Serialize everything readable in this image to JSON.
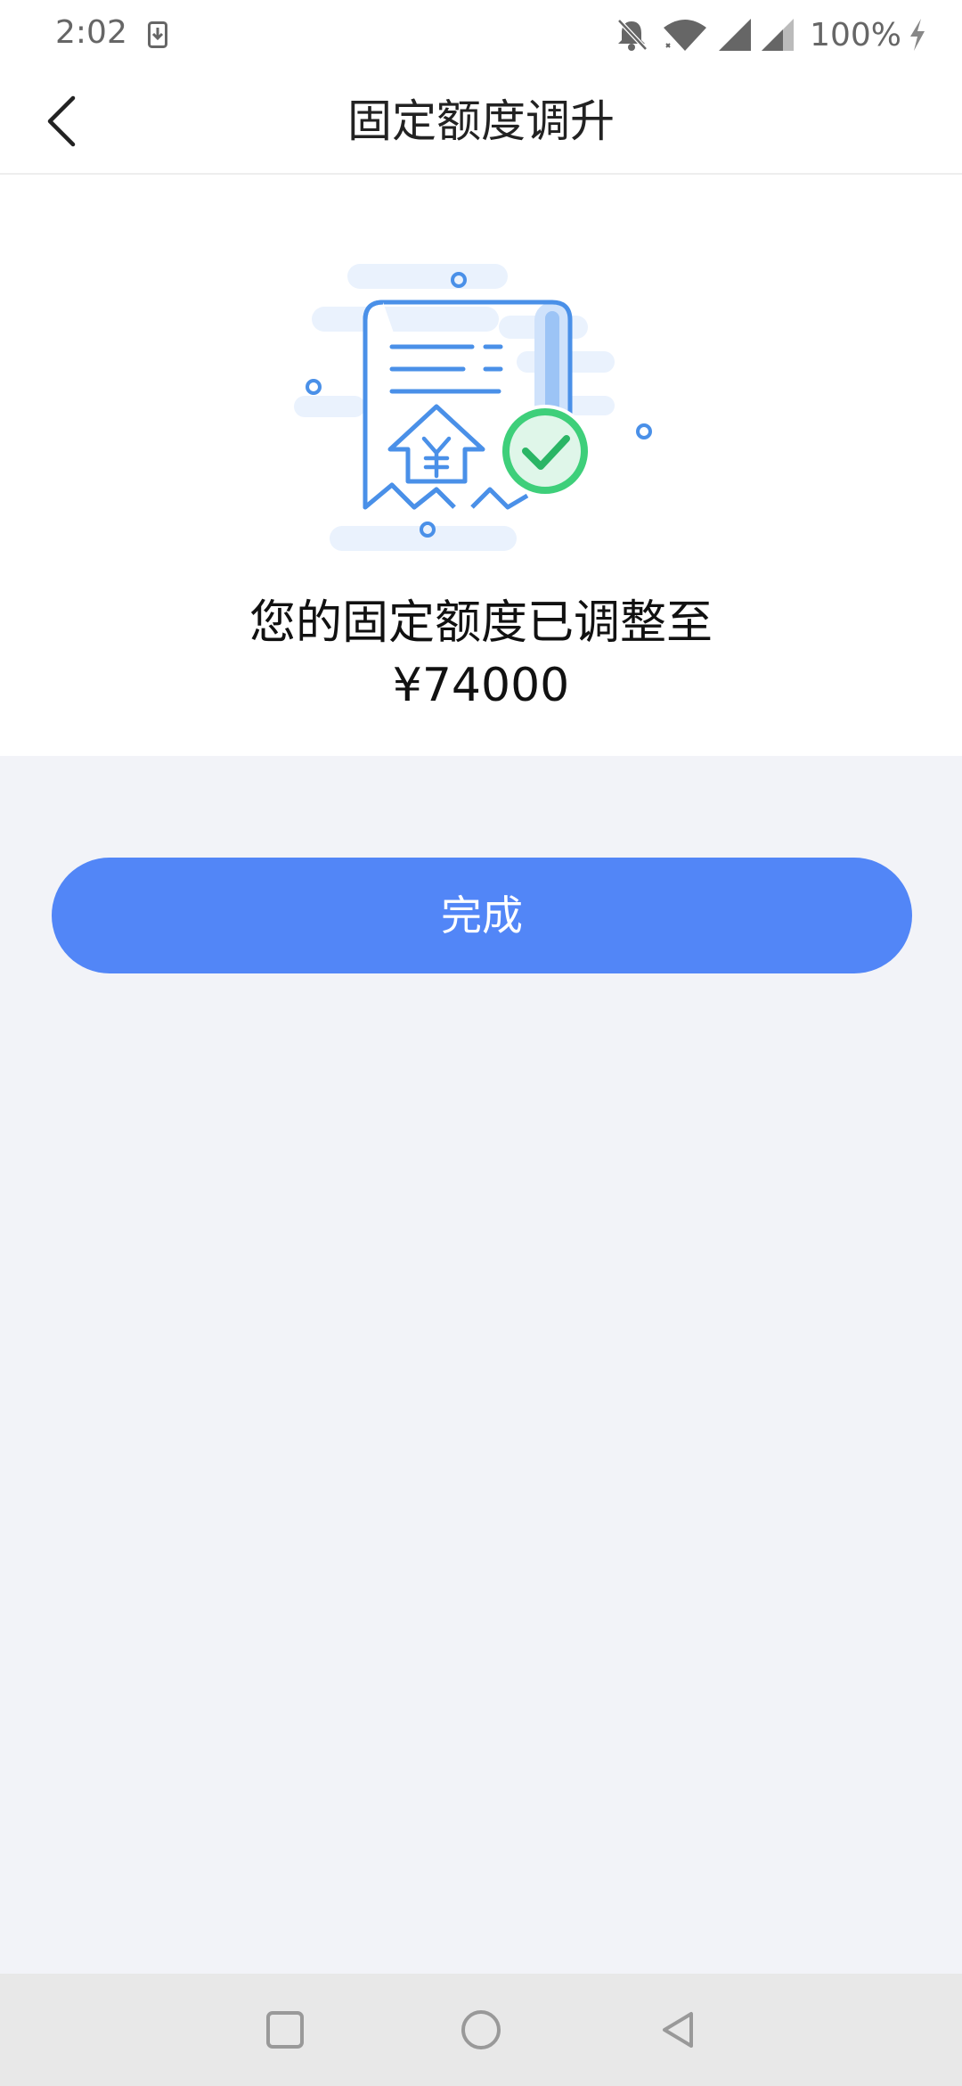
{
  "status_bar": {
    "time": "2:02",
    "battery": "100%",
    "icons": [
      "download-icon",
      "bell-off-icon",
      "wifi-icon",
      "signal-icon",
      "signal-icon-2",
      "charging-icon"
    ]
  },
  "nav": {
    "title": "固定额度调升",
    "back_icon": "chevron-left-icon"
  },
  "result": {
    "message": "您的固定额度已调整至",
    "amount": "¥74000",
    "illustration": "receipt-success-illustration"
  },
  "actions": {
    "done_label": "完成"
  },
  "system_nav": {
    "icons": [
      "recents-icon",
      "home-icon",
      "back-triangle-icon"
    ]
  },
  "colors": {
    "primary": "#5286f7",
    "success": "#3ecf7a",
    "page_bg": "#f2f3f8",
    "card_bg": "#ffffff"
  }
}
